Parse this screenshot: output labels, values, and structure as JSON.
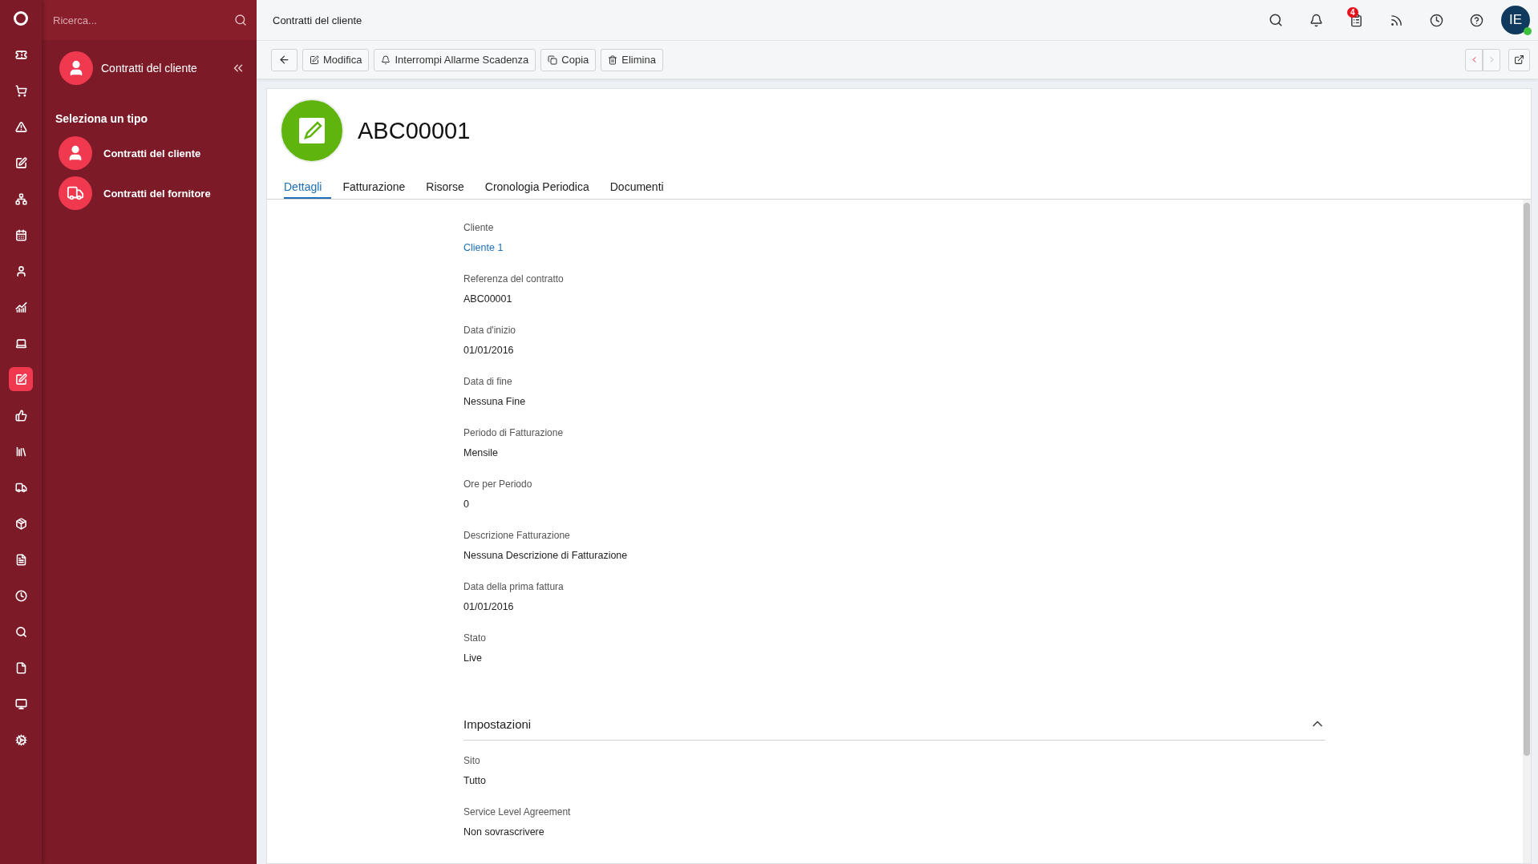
{
  "rail": {
    "items": [
      {
        "kind": "logo",
        "selected": false
      },
      {
        "kind": "ticket",
        "selected": false
      },
      {
        "kind": "cart",
        "selected": false
      },
      {
        "kind": "warning",
        "selected": false
      },
      {
        "kind": "edit",
        "selected": false
      },
      {
        "kind": "hierarchy",
        "selected": false
      },
      {
        "kind": "calendar",
        "selected": false
      },
      {
        "kind": "person",
        "selected": false
      },
      {
        "kind": "chart",
        "selected": false
      },
      {
        "kind": "laptop",
        "selected": false
      },
      {
        "kind": "contract",
        "selected": true
      },
      {
        "kind": "thumb",
        "selected": false
      },
      {
        "kind": "books",
        "selected": false
      },
      {
        "kind": "truck",
        "selected": false
      },
      {
        "kind": "box",
        "selected": false
      },
      {
        "kind": "document",
        "selected": false
      },
      {
        "kind": "clock",
        "selected": false
      },
      {
        "kind": "search",
        "selected": false
      },
      {
        "kind": "file",
        "selected": false
      },
      {
        "kind": "monitor",
        "selected": false
      },
      {
        "kind": "cogs",
        "selected": false
      }
    ]
  },
  "sidebar": {
    "search": {
      "placeholder": "Ricerca..."
    },
    "title": "Contratti del cliente",
    "section_title": "Seleziona un tipo",
    "items": [
      {
        "kind": "person",
        "label": "Contratti del cliente"
      },
      {
        "kind": "truck",
        "label": "Contratti del fornitore"
      }
    ]
  },
  "topbar": {
    "breadcrumb": "Contratti del cliente",
    "notification_count": "4",
    "avatar": {
      "initials": "IE",
      "online": true
    }
  },
  "toolbar": {
    "buttons": [
      {
        "kind": "back"
      },
      {
        "kind": "edit",
        "label": "Modifica"
      },
      {
        "kind": "bell",
        "label": "Interrompi Allarme Scadenza"
      },
      {
        "kind": "copy",
        "label": "Copia"
      },
      {
        "kind": "delete",
        "label": "Elimina"
      }
    ],
    "prev": {
      "disabled": false
    },
    "next": {
      "disabled": true
    }
  },
  "record": {
    "title": "ABC00001",
    "tabs": [
      {
        "label": "Dettagli",
        "selected": true
      },
      {
        "label": "Fatturazione",
        "selected": false
      },
      {
        "label": "Risorse",
        "selected": false
      },
      {
        "label": "Cronologia Periodica",
        "selected": false
      },
      {
        "label": "Documenti",
        "selected": false
      }
    ],
    "fields": [
      {
        "label": "Cliente",
        "value": "Cliente 1",
        "kind": "link"
      },
      {
        "label": "Referenza del contratto",
        "value": "ABC00001",
        "kind": "text"
      },
      {
        "label": "Data d'inizio",
        "value": "01/01/2016",
        "kind": "text"
      },
      {
        "label": "Data di fine",
        "value": "Nessuna Fine",
        "kind": "text"
      },
      {
        "label": "Periodo di Fatturazione",
        "value": "Mensile",
        "kind": "text"
      },
      {
        "label": "Ore per Periodo",
        "value": "0",
        "kind": "text"
      },
      {
        "label": "Descrizione Fatturazione",
        "value": "Nessuna Descrizione di Fatturazione",
        "kind": "text"
      },
      {
        "label": "Data della prima fattura",
        "value": "01/01/2016",
        "kind": "text"
      },
      {
        "label": "Stato",
        "value": "Live",
        "kind": "text"
      }
    ],
    "section": {
      "title": "Impostazioni",
      "expanded": true,
      "fields": [
        {
          "label": "Sito",
          "value": "Tutto",
          "kind": "text"
        },
        {
          "label": "Service Level Agreement",
          "value": "Non sovrascrivere",
          "kind": "text"
        }
      ]
    }
  }
}
